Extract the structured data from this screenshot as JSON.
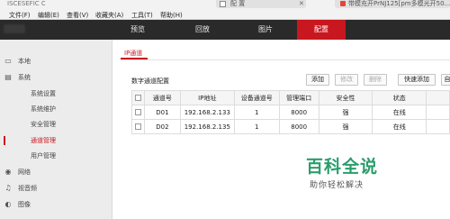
{
  "browser": {
    "tabs": [
      {
        "label": "ISCESEFIC O"
      },
      {
        "label": "配 置"
      },
      {
        "label": "带模充开PrNJ125[pm多模光开50..."
      }
    ],
    "menu": [
      "文件(F)",
      "编辑(E)",
      "查看(V)",
      "收藏夹(A)",
      "工具(T)",
      "帮助(H)"
    ]
  },
  "topnav": {
    "items": [
      "预览",
      "回放",
      "图片",
      "配置"
    ]
  },
  "sidebar": {
    "items": [
      {
        "label": "本地",
        "icon": "monitor-icon"
      },
      {
        "label": "系统",
        "icon": "system-icon"
      },
      {
        "label": "系统设置"
      },
      {
        "label": "系统维护"
      },
      {
        "label": "安全管理"
      },
      {
        "label": "通道管理"
      },
      {
        "label": "用户管理"
      },
      {
        "label": "网络",
        "icon": "globe-icon"
      },
      {
        "label": "视音频",
        "icon": "video-audio-icon"
      },
      {
        "label": "图像",
        "icon": "image-icon"
      }
    ]
  },
  "main": {
    "tab": "IP通道",
    "section_title": "数字通道配置",
    "buttons": {
      "add": "添加",
      "edit": "修改",
      "delete": "删除",
      "quick_add": "快速添加",
      "more": "自"
    },
    "table": {
      "headers": [
        "通道号",
        "IP地址",
        "设备通道号",
        "管理端口",
        "安全性",
        "状态"
      ],
      "rows": [
        [
          "D01",
          "192.168.2.133",
          "1",
          "8000",
          "强",
          "在线"
        ],
        [
          "D02",
          "192.168.2.135",
          "1",
          "8000",
          "强",
          "在线"
        ]
      ]
    }
  },
  "watermark": {
    "title": "百科全说",
    "subtitle": "助你轻松解决"
  },
  "colors": {
    "accent": "#c9171f",
    "nav_bg": "#2a2a2a",
    "sidebar_bg": "#ececec",
    "watermark": "#2a9d6b"
  }
}
